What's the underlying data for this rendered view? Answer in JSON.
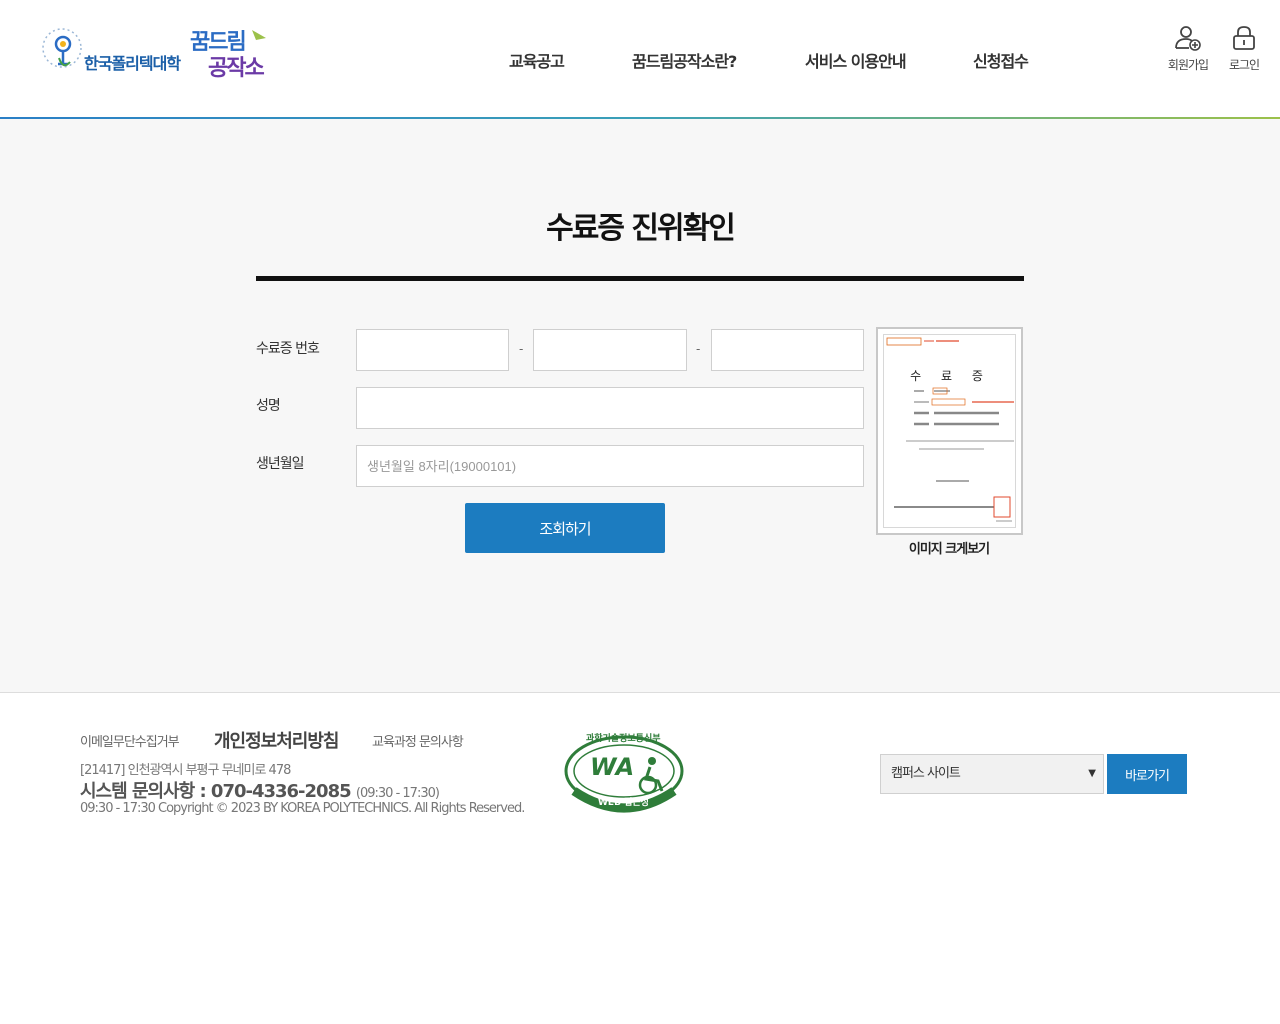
{
  "header": {
    "logo_text": "한국폴리텍대학",
    "brand_line1": "꿈드림",
    "brand_line2": "공작소",
    "nav": [
      {
        "label": "교육공고"
      },
      {
        "label": "꿈드림공작소란?"
      },
      {
        "label": "서비스 이용안내"
      },
      {
        "label": "신청접수"
      }
    ],
    "signup_label": "회원가입",
    "login_label": "로그인"
  },
  "main": {
    "title": "수료증 진위확인",
    "form": {
      "cert_number_label": "수료증 번호",
      "name_label": "성명",
      "birth_label": "생년월일",
      "birth_placeholder": "생년월일 8자리(19000101)",
      "dash": "-",
      "submit_label": "조회하기"
    },
    "certificate": {
      "doc_title": "수 료 증",
      "caption": "이미지 크게보기"
    }
  },
  "footer": {
    "links": [
      "이메일무단수집거부",
      "개인정보처리방침",
      "교육과정 문의사항"
    ],
    "address": "[21417] 인천광역시 부평구 무네미로 478",
    "phone_label": "시스템 문의사항 : 070-4336-2085",
    "phone_hours": "(09:30 - 17:30)",
    "copyright": "09:30 - 17:30 Copyright © 2023 BY KOREA POLYTECHNICS. All Rights Reserved.",
    "wa_mark": {
      "top_text": "과학기술정보통신부",
      "center": "WA",
      "bottom_text": "WEB 접근성"
    },
    "campus_select_value": "캠퍼스 사이트",
    "go_label": "바로가기"
  },
  "colors": {
    "accent": "#1c7cc0",
    "header_gradient": [
      "#2a7fc6",
      "#9cc14a"
    ]
  }
}
